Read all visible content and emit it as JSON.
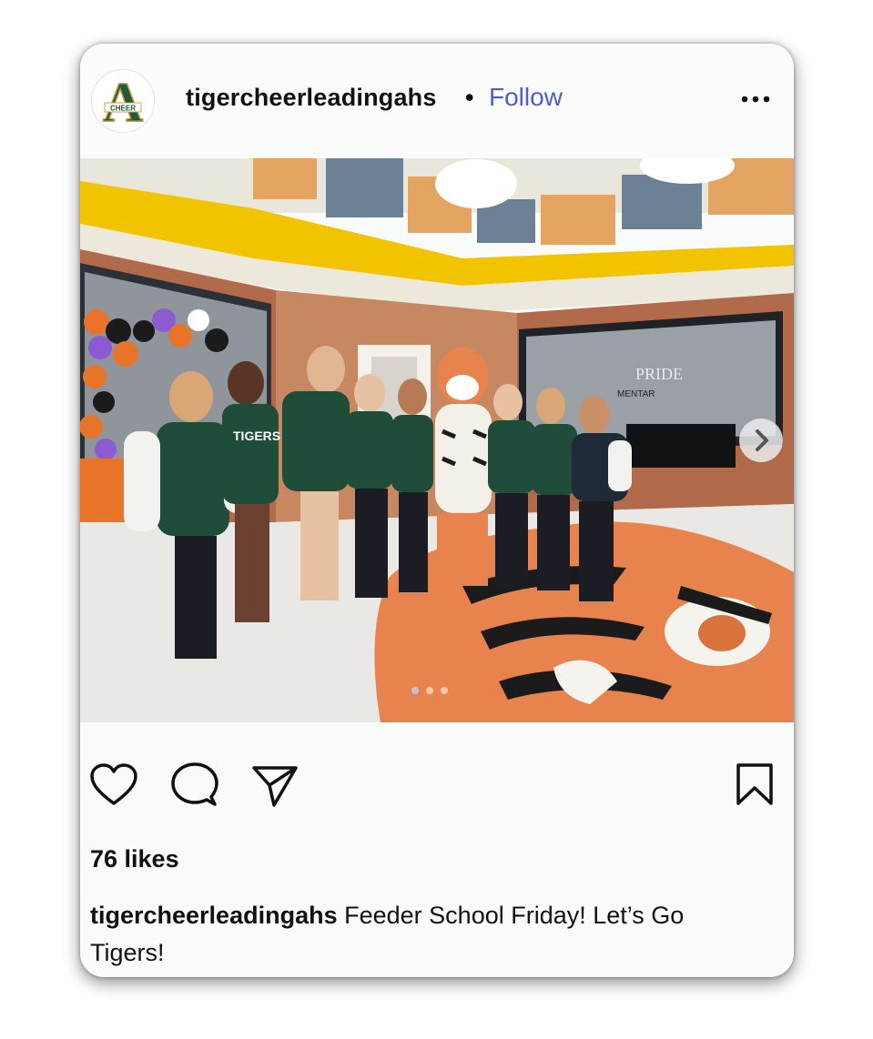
{
  "post": {
    "username": "tigercheerleadingahs",
    "separator": "•",
    "follow_label": "Follow",
    "more_icon": "more-horizontal-icon",
    "avatar_letter": "A",
    "avatar_text": "CHEER",
    "photo_sign_1": "PRIDE",
    "photo_sign_2": "MENTAR",
    "photo_shirt_text": "TIGERS",
    "likes": "76 likes",
    "caption_user": "tigercheerleadingahs",
    "caption_text": "Feeder School Friday! Let’s Go Tigers!"
  },
  "icons": {
    "like": "heart-icon",
    "comment": "comment-icon",
    "share": "paper-plane-icon",
    "save": "bookmark-icon",
    "next": "chevron-right-icon"
  },
  "carousel": {
    "count": 3,
    "active_index": 0
  },
  "colors": {
    "follow": "#4f5bd5",
    "text": "#111111",
    "background": "#f9fafa",
    "school_green": "#1f4d3a",
    "tiger_orange": "#e9834d"
  }
}
